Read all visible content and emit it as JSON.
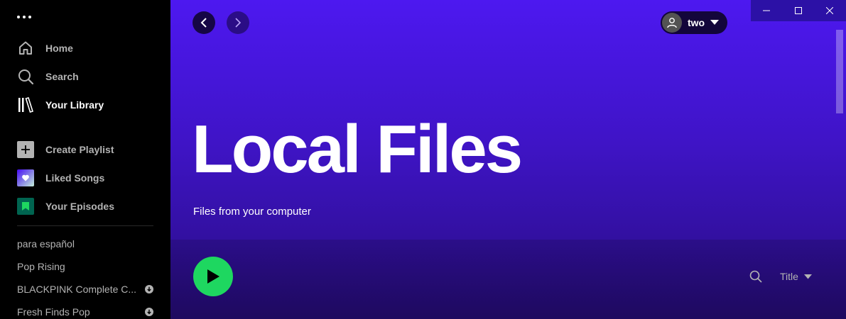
{
  "sidebar": {
    "menu_icon": "more-dots-icon",
    "nav": [
      {
        "label": "Home",
        "icon": "home-icon"
      },
      {
        "label": "Search",
        "icon": "search-icon"
      },
      {
        "label": "Your Library",
        "icon": "library-icon"
      }
    ],
    "actions": [
      {
        "label": "Create Playlist",
        "icon": "plus-icon"
      },
      {
        "label": "Liked Songs",
        "icon": "heart-icon"
      },
      {
        "label": "Your Episodes",
        "icon": "bookmark-icon"
      }
    ],
    "playlists": [
      {
        "name": "para español",
        "downloaded": false
      },
      {
        "name": "Pop Rising",
        "downloaded": false
      },
      {
        "name": "BLACKPINK Complete C...",
        "downloaded": true
      },
      {
        "name": "Fresh Finds Pop",
        "downloaded": true
      }
    ]
  },
  "header": {
    "user_name": "two"
  },
  "page": {
    "title": "Local Files",
    "subtitle": "Files from your computer"
  },
  "controls": {
    "sort_label": "Title"
  },
  "colors": {
    "accent_green": "#1ed760",
    "main_gradient_top": "#4d18f0",
    "sidebar_bg": "#000000"
  }
}
